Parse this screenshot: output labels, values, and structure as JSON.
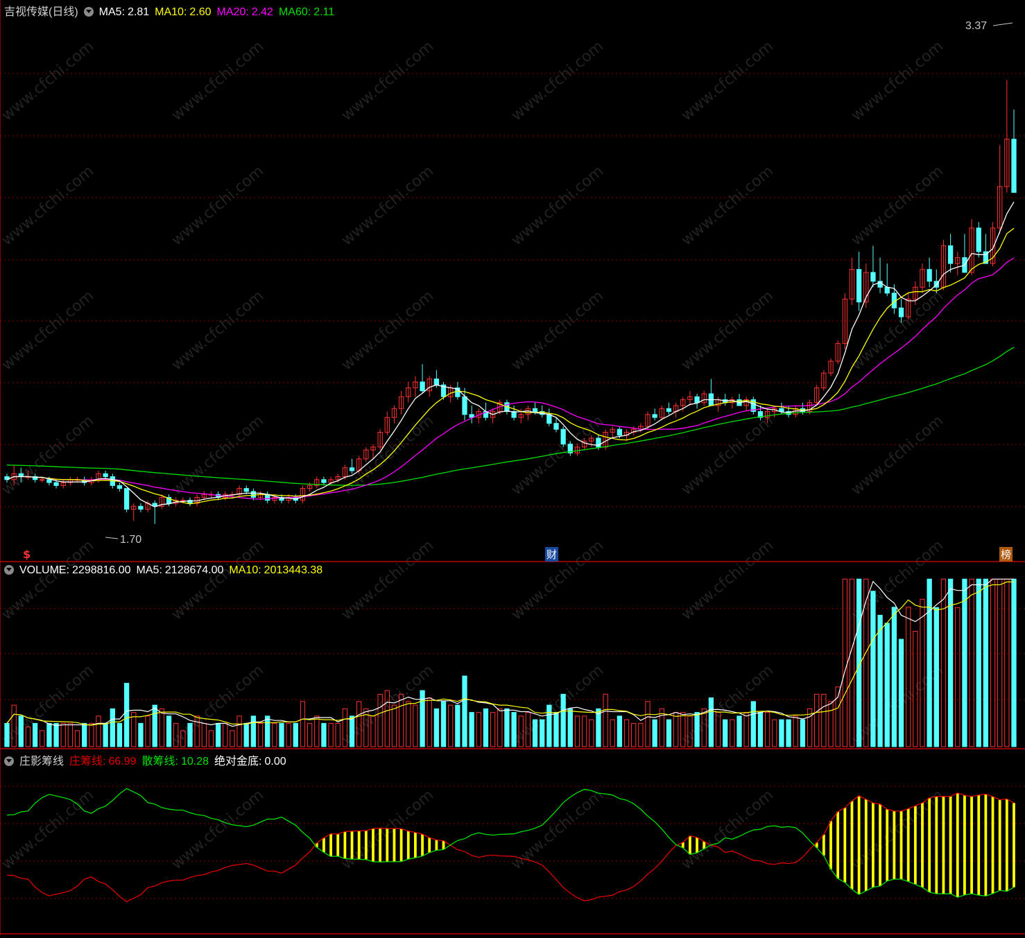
{
  "colors": {
    "bg": "#000000",
    "up": "#ff3232",
    "down": "#54ffff",
    "ma5": "#ffffff",
    "ma10": "#ffff00",
    "ma20": "#ff00ff",
    "ma60": "#00e000",
    "grid": "#8a0000",
    "watermark": "#3a3a3a",
    "zhuang": "#e00000",
    "san": "#00e000",
    "fill": "#ffff00"
  },
  "price_panel": {
    "title": "吉视传媒(日线)",
    "ma5_label": "MA5:",
    "ma5_value": "2.81",
    "ma10_label": "MA10:",
    "ma10_value": "2.60",
    "ma20_label": "MA20:",
    "ma20_value": "2.42",
    "ma60_label": "MA60:",
    "ma60_value": "2.11",
    "high_marker": "3.37",
    "low_marker": "1.70",
    "markers": {
      "left": "$",
      "middle": "财",
      "right": "榜"
    }
  },
  "volume_panel": {
    "title": "VOLUME:",
    "volume_value": "2298816.00",
    "ma5_label": "MA5:",
    "ma5_value": "2128674.00",
    "ma10_label": "MA10:",
    "ma10_value": "2013443.38"
  },
  "chip_panel": {
    "title": "庄影筹线",
    "zhuang_label": "庄筹线:",
    "zhuang_value": "66.99",
    "san_label": "散筹线:",
    "san_value": "10.28",
    "gold_label": "绝对金底:",
    "gold_value": "0.00"
  },
  "watermark_text": "www.cfchi.com",
  "chart_data": {
    "type": "candlestick",
    "price_range": [
      1.62,
      3.4
    ],
    "candles": [
      [
        1.86,
        1.87,
        1.84,
        1.85
      ],
      [
        1.85,
        1.9,
        1.83,
        1.87
      ],
      [
        1.87,
        1.89,
        1.84,
        1.86
      ],
      [
        1.86,
        1.88,
        1.85,
        1.86
      ],
      [
        1.86,
        1.87,
        1.84,
        1.85
      ],
      [
        1.85,
        1.86,
        1.84,
        1.85
      ],
      [
        1.85,
        1.86,
        1.83,
        1.84
      ],
      [
        1.84,
        1.85,
        1.82,
        1.83
      ],
      [
        1.83,
        1.85,
        1.82,
        1.84
      ],
      [
        1.84,
        1.86,
        1.83,
        1.85
      ],
      [
        1.85,
        1.86,
        1.84,
        1.85
      ],
      [
        1.85,
        1.86,
        1.83,
        1.84
      ],
      [
        1.84,
        1.86,
        1.83,
        1.85
      ],
      [
        1.85,
        1.88,
        1.84,
        1.87
      ],
      [
        1.87,
        1.88,
        1.85,
        1.86
      ],
      [
        1.86,
        1.87,
        1.82,
        1.83
      ],
      [
        1.83,
        1.84,
        1.81,
        1.82
      ],
      [
        1.82,
        1.82,
        1.74,
        1.75
      ],
      [
        1.75,
        1.77,
        1.71,
        1.76
      ],
      [
        1.76,
        1.77,
        1.74,
        1.75
      ],
      [
        1.75,
        1.78,
        1.74,
        1.77
      ],
      [
        1.77,
        1.78,
        1.7,
        1.76
      ],
      [
        1.76,
        1.8,
        1.75,
        1.79
      ],
      [
        1.79,
        1.8,
        1.76,
        1.77
      ],
      [
        1.77,
        1.79,
        1.76,
        1.78
      ],
      [
        1.78,
        1.79,
        1.77,
        1.78
      ],
      [
        1.78,
        1.79,
        1.76,
        1.77
      ],
      [
        1.77,
        1.8,
        1.76,
        1.79
      ],
      [
        1.79,
        1.81,
        1.78,
        1.8
      ],
      [
        1.8,
        1.81,
        1.79,
        1.8
      ],
      [
        1.8,
        1.81,
        1.78,
        1.79
      ],
      [
        1.79,
        1.81,
        1.78,
        1.8
      ],
      [
        1.8,
        1.81,
        1.79,
        1.8
      ],
      [
        1.8,
        1.83,
        1.79,
        1.82
      ],
      [
        1.82,
        1.83,
        1.8,
        1.81
      ],
      [
        1.81,
        1.82,
        1.78,
        1.79
      ],
      [
        1.79,
        1.81,
        1.78,
        1.8
      ],
      [
        1.8,
        1.81,
        1.77,
        1.78
      ],
      [
        1.78,
        1.8,
        1.77,
        1.79
      ],
      [
        1.79,
        1.8,
        1.77,
        1.78
      ],
      [
        1.78,
        1.8,
        1.77,
        1.79
      ],
      [
        1.79,
        1.8,
        1.77,
        1.78
      ],
      [
        1.78,
        1.83,
        1.77,
        1.82
      ],
      [
        1.82,
        1.84,
        1.81,
        1.83
      ],
      [
        1.83,
        1.86,
        1.82,
        1.85
      ],
      [
        1.85,
        1.86,
        1.83,
        1.84
      ],
      [
        1.84,
        1.86,
        1.83,
        1.85
      ],
      [
        1.85,
        1.87,
        1.84,
        1.86
      ],
      [
        1.86,
        1.9,
        1.85,
        1.89
      ],
      [
        1.89,
        1.92,
        1.87,
        1.88
      ],
      [
        1.88,
        1.93,
        1.87,
        1.92
      ],
      [
        1.92,
        1.96,
        1.91,
        1.95
      ],
      [
        1.95,
        1.97,
        1.92,
        1.96
      ],
      [
        1.96,
        2.02,
        1.95,
        2.01
      ],
      [
        2.01,
        2.08,
        2.0,
        2.06
      ],
      [
        2.06,
        2.1,
        2.04,
        2.09
      ],
      [
        2.09,
        2.15,
        2.07,
        2.13
      ],
      [
        2.13,
        2.18,
        2.11,
        2.16
      ],
      [
        2.16,
        2.2,
        2.13,
        2.18
      ],
      [
        2.18,
        2.24,
        2.14,
        2.15
      ],
      [
        2.15,
        2.2,
        2.13,
        2.19
      ],
      [
        2.19,
        2.22,
        2.16,
        2.17
      ],
      [
        2.17,
        2.18,
        2.12,
        2.13
      ],
      [
        2.13,
        2.17,
        2.11,
        2.16
      ],
      [
        2.16,
        2.18,
        2.12,
        2.13
      ],
      [
        2.13,
        2.16,
        2.05,
        2.07
      ],
      [
        2.07,
        2.1,
        2.04,
        2.06
      ],
      [
        2.06,
        2.09,
        2.04,
        2.08
      ],
      [
        2.08,
        2.11,
        2.05,
        2.06
      ],
      [
        2.06,
        2.09,
        2.04,
        2.08
      ],
      [
        2.08,
        2.12,
        2.07,
        2.11
      ],
      [
        2.11,
        2.12,
        2.07,
        2.08
      ],
      [
        2.08,
        2.1,
        2.05,
        2.06
      ],
      [
        2.06,
        2.09,
        2.04,
        2.07
      ],
      [
        2.07,
        2.1,
        2.05,
        2.09
      ],
      [
        2.09,
        2.11,
        2.07,
        2.08
      ],
      [
        2.08,
        2.1,
        2.06,
        2.07
      ],
      [
        2.07,
        2.09,
        2.03,
        2.04
      ],
      [
        2.04,
        2.06,
        2.01,
        2.02
      ],
      [
        2.02,
        2.03,
        1.96,
        1.97
      ],
      [
        1.97,
        1.98,
        1.93,
        1.94
      ],
      [
        1.94,
        1.97,
        1.93,
        1.96
      ],
      [
        1.96,
        1.99,
        1.95,
        1.98
      ],
      [
        1.98,
        2.0,
        1.96,
        1.99
      ],
      [
        1.99,
        2.0,
        1.95,
        1.96
      ],
      [
        1.96,
        2.02,
        1.95,
        2.01
      ],
      [
        2.01,
        2.03,
        1.99,
        2.02
      ],
      [
        2.02,
        2.03,
        1.99,
        2.0
      ],
      [
        2.0,
        2.02,
        1.98,
        2.01
      ],
      [
        2.01,
        2.03,
        2.0,
        2.02
      ],
      [
        2.02,
        2.04,
        2.01,
        2.03
      ],
      [
        2.03,
        2.08,
        2.02,
        2.07
      ],
      [
        2.07,
        2.09,
        2.05,
        2.06
      ],
      [
        2.06,
        2.1,
        2.05,
        2.09
      ],
      [
        2.09,
        2.11,
        2.07,
        2.08
      ],
      [
        2.08,
        2.11,
        2.06,
        2.1
      ],
      [
        2.1,
        2.13,
        2.08,
        2.12
      ],
      [
        2.12,
        2.15,
        2.1,
        2.13
      ],
      [
        2.13,
        2.14,
        2.09,
        2.11
      ],
      [
        2.11,
        2.15,
        2.1,
        2.14
      ],
      [
        2.14,
        2.19,
        2.12,
        2.1
      ],
      [
        2.1,
        2.13,
        2.08,
        2.12
      ],
      [
        2.12,
        2.14,
        2.1,
        2.11
      ],
      [
        2.11,
        2.13,
        2.09,
        2.12
      ],
      [
        2.12,
        2.14,
        2.1,
        2.1
      ],
      [
        2.1,
        2.13,
        2.08,
        2.12
      ],
      [
        2.12,
        2.13,
        2.07,
        2.08
      ],
      [
        2.08,
        2.1,
        2.05,
        2.06
      ],
      [
        2.06,
        2.09,
        2.04,
        2.08
      ],
      [
        2.08,
        2.1,
        2.06,
        2.09
      ],
      [
        2.09,
        2.11,
        2.07,
        2.08
      ],
      [
        2.08,
        2.1,
        2.06,
        2.07
      ],
      [
        2.07,
        2.1,
        2.06,
        2.09
      ],
      [
        2.09,
        2.11,
        2.07,
        2.08
      ],
      [
        2.08,
        2.12,
        2.07,
        2.11
      ],
      [
        2.11,
        2.17,
        2.1,
        2.16
      ],
      [
        2.16,
        2.22,
        2.15,
        2.21
      ],
      [
        2.21,
        2.26,
        2.2,
        2.25
      ],
      [
        2.25,
        2.32,
        2.24,
        2.31
      ],
      [
        2.31,
        2.48,
        2.29,
        2.46
      ],
      [
        2.46,
        2.6,
        2.44,
        2.56
      ],
      [
        2.56,
        2.62,
        2.42,
        2.45
      ],
      [
        2.45,
        2.58,
        2.43,
        2.55
      ],
      [
        2.55,
        2.64,
        2.5,
        2.52
      ],
      [
        2.52,
        2.6,
        2.48,
        2.5
      ],
      [
        2.5,
        2.58,
        2.47,
        2.48
      ],
      [
        2.48,
        2.51,
        2.41,
        2.43
      ],
      [
        2.43,
        2.46,
        2.38,
        2.4
      ],
      [
        2.4,
        2.48,
        2.39,
        2.46
      ],
      [
        2.46,
        2.52,
        2.44,
        2.5
      ],
      [
        2.5,
        2.58,
        2.48,
        2.56
      ],
      [
        2.56,
        2.6,
        2.5,
        2.52
      ],
      [
        2.52,
        2.56,
        2.48,
        2.5
      ],
      [
        2.5,
        2.66,
        2.49,
        2.64
      ],
      [
        2.64,
        2.68,
        2.55,
        2.58
      ],
      [
        2.58,
        2.62,
        2.54,
        2.6
      ],
      [
        2.6,
        2.68,
        2.57,
        2.55
      ],
      [
        2.55,
        2.73,
        2.54,
        2.7
      ],
      [
        2.7,
        2.72,
        2.6,
        2.62
      ],
      [
        2.62,
        2.68,
        2.58,
        2.58
      ],
      [
        2.58,
        2.72,
        2.57,
        2.7
      ],
      [
        2.7,
        2.98,
        2.68,
        2.84
      ],
      [
        2.84,
        3.2,
        2.82,
        3.0
      ],
      [
        3.0,
        3.1,
        2.85,
        2.82
      ]
    ]
  }
}
